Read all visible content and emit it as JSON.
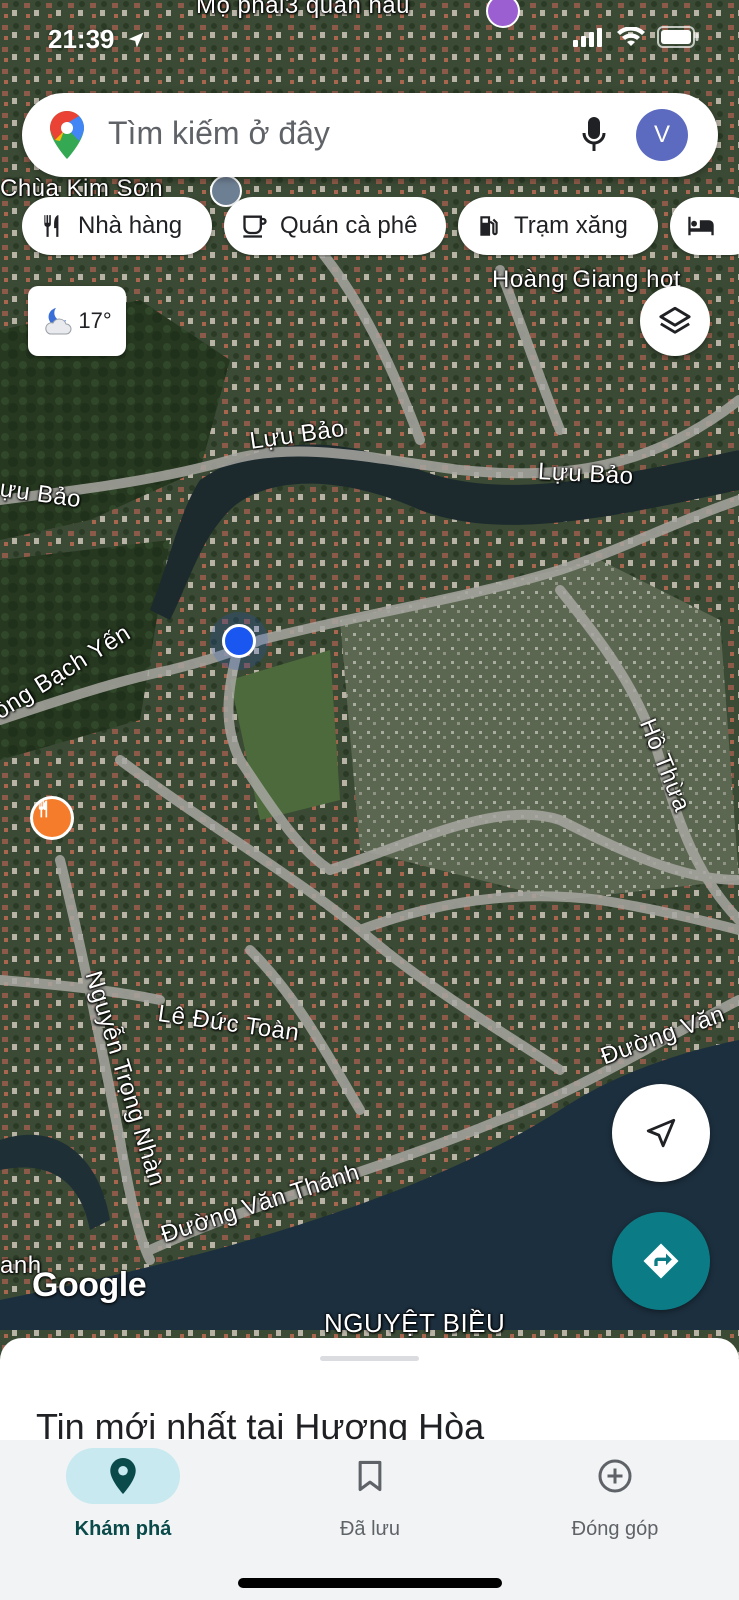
{
  "status": {
    "time": "21:39"
  },
  "search": {
    "placeholder": "Tìm kiếm ở đây",
    "avatar_letter": "V"
  },
  "chips": [
    {
      "label": "Nhà hàng",
      "icon": "restaurant-icon"
    },
    {
      "label": "Quán cà phê",
      "icon": "coffee-icon"
    },
    {
      "label": "Trạm xăng",
      "icon": "gas-station-icon"
    },
    {
      "label": "",
      "icon": "hotel-icon"
    }
  ],
  "weather": {
    "temp": "17°",
    "icon": "night-cloud-icon"
  },
  "map_labels": {
    "top_poi": "Mộ phái3 quán hâu",
    "temple": "Chùa Kim Sơn",
    "hotel": "Hoàng Giang hot",
    "road1": "Lựu Bảo",
    "road2": "Lựu Bảo",
    "road3": "ựu Bảo",
    "river": "ông Bạch Yến",
    "road4": "Hồ Thừa",
    "road5": "Lê Đức Toàn",
    "road6": "Nguyễn Trọng Nhàn",
    "road7": "Đường Văn Thánh",
    "road8": "Đường Văn",
    "road9": "anh",
    "area": "NGUYỆT BIỀU"
  },
  "google_logo": "Google",
  "sheet": {
    "title": "Tin mới nhất tại Hương Hòa"
  },
  "nav": [
    {
      "label": "Khám phá",
      "icon": "explore-pin-icon"
    },
    {
      "label": "Đã lưu",
      "icon": "bookmark-icon"
    },
    {
      "label": "Đóng góp",
      "icon": "add-circle-icon"
    }
  ],
  "colors": {
    "accent": "#0b7c86",
    "location_dot": "#1a56f0",
    "avatar": "#5c6bc0",
    "nav_active_pill": "#c7e9ef"
  }
}
